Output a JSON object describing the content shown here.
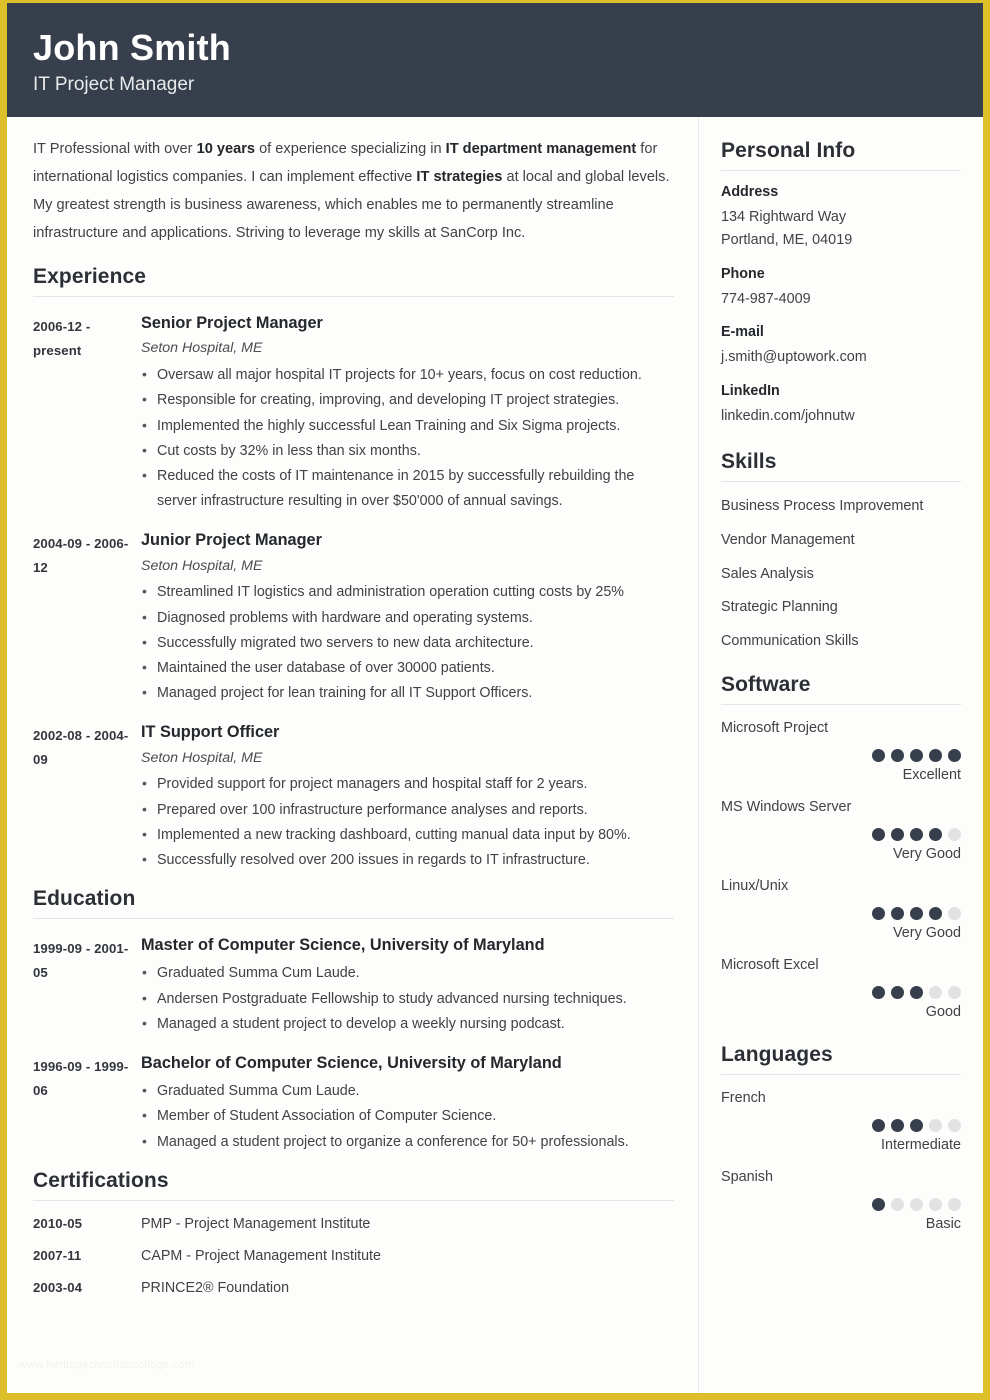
{
  "header": {
    "name": "John Smith",
    "title": "IT Project Manager"
  },
  "summary": {
    "part1": "IT Professional with over ",
    "bold1": "10 years",
    "part2": " of experience specializing in ",
    "bold2": "IT department management",
    "part3": " for international logistics companies. I can implement effective ",
    "bold3": "IT strategies",
    "part4": " at local and global levels. My greatest strength is business awareness, which enables me to permanently streamline infrastructure and applications. Striving to leverage my skills at SanCorp Inc."
  },
  "sections": {
    "experience": "Experience",
    "education": "Education",
    "certifications": "Certifications"
  },
  "experience": [
    {
      "date": "2006-12 - present",
      "role": "Senior Project Manager",
      "org": "Seton Hospital, ME",
      "bullets": [
        "Oversaw all major hospital IT projects for 10+ years, focus on cost reduction.",
        "Responsible for creating, improving, and developing IT project strategies.",
        "Implemented the highly successful Lean Training and Six Sigma projects.",
        "Cut costs by 32% in less than six months.",
        "Reduced the costs of IT maintenance in 2015 by successfully rebuilding the server infrastructure resulting in over $50'000 of annual savings."
      ]
    },
    {
      "date": "2004-09 - 2006-12",
      "role": "Junior Project Manager",
      "org": "Seton Hospital, ME",
      "bullets": [
        "Streamlined IT logistics and administration operation cutting costs by 25%",
        "Diagnosed problems with hardware and operating systems.",
        "Successfully migrated two servers to new data architecture.",
        "Maintained the user database of over 30000 patients.",
        "Managed project for lean training for all IT Support Officers."
      ]
    },
    {
      "date": "2002-08 - 2004-09",
      "role": "IT Support Officer",
      "org": "Seton Hospital, ME",
      "bullets": [
        "Provided support for project managers and hospital staff for 2 years.",
        "Prepared over 100 infrastructure performance analyses and reports.",
        "Implemented a new tracking dashboard, cutting manual data input by 80%.",
        "Successfully resolved over 200 issues in regards to IT infrastructure."
      ]
    }
  ],
  "education": [
    {
      "date": "1999-09 - 2001-05",
      "role": "Master of Computer Science, University of Maryland",
      "bullets": [
        "Graduated Summa Cum Laude.",
        "Andersen Postgraduate Fellowship to study advanced nursing techniques.",
        "Managed a student project to develop a weekly nursing podcast."
      ]
    },
    {
      "date": "1996-09 - 1999-06",
      "role": "Bachelor of Computer Science, University of Maryland",
      "bullets": [
        "Graduated Summa Cum Laude.",
        "Member of Student Association of Computer Science.",
        "Managed a student project to organize a conference for 50+ professionals."
      ]
    }
  ],
  "certifications": [
    {
      "date": "2010-05",
      "name": "PMP - Project Management Institute"
    },
    {
      "date": "2007-11",
      "name": "CAPM - Project Management Institute"
    },
    {
      "date": "2003-04",
      "name": "PRINCE2® Foundation"
    }
  ],
  "watermark": "www.heritagechristiancollege.com",
  "sidebar": {
    "personal_info": {
      "heading": "Personal Info",
      "fields": [
        {
          "label": "Address",
          "lines": [
            "134 Rightward Way",
            "Portland, ME, 04019"
          ]
        },
        {
          "label": "Phone",
          "lines": [
            "774-987-4009"
          ]
        },
        {
          "label": "E-mail",
          "lines": [
            "j.smith@uptowork.com"
          ]
        },
        {
          "label": "LinkedIn",
          "lines": [
            "linkedin.com/johnutw"
          ]
        }
      ]
    },
    "skills": {
      "heading": "Skills",
      "items": [
        "Business Process Improvement",
        "Vendor Management",
        "Sales Analysis",
        "Strategic Planning",
        "Communication Skills"
      ]
    },
    "software": {
      "heading": "Software",
      "items": [
        {
          "name": "Microsoft Project",
          "filled": 5,
          "total": 5,
          "level": "Excellent"
        },
        {
          "name": "MS Windows Server",
          "filled": 4,
          "total": 5,
          "level": "Very Good"
        },
        {
          "name": "Linux/Unix",
          "filled": 4,
          "total": 5,
          "level": "Very Good"
        },
        {
          "name": "Microsoft Excel",
          "filled": 3,
          "total": 5,
          "level": "Good"
        }
      ]
    },
    "languages": {
      "heading": "Languages",
      "items": [
        {
          "name": "French",
          "filled": 3,
          "total": 5,
          "level": "Intermediate"
        },
        {
          "name": "Spanish",
          "filled": 1,
          "total": 5,
          "level": "Basic"
        }
      ]
    }
  },
  "colors": {
    "accent": "#ddc029",
    "header_bg": "#373f4c",
    "dot_on": "#373f4c",
    "dot_off": "#e2e2e2"
  }
}
